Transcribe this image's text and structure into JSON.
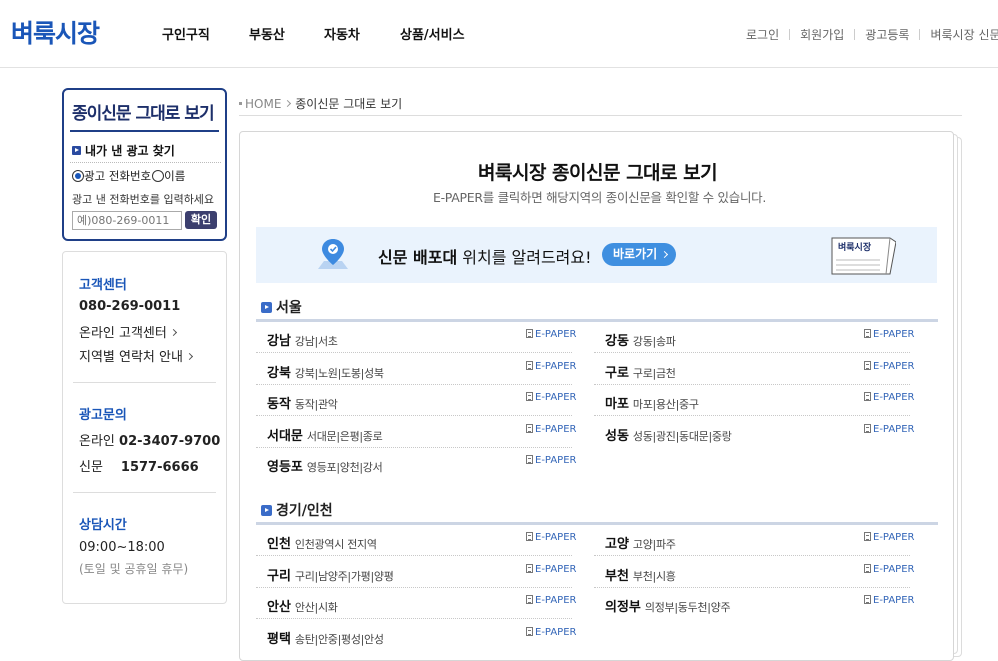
{
  "header": {
    "logo": "벼룩시장",
    "nav": [
      "구인구직",
      "부동산",
      "자동차",
      "상품/서비스"
    ],
    "util": [
      "로그인",
      "회원가입",
      "광고등록",
      "벼룩시장 신문보기"
    ]
  },
  "sidebar": {
    "search": {
      "title": "종이신문 그대로 보기",
      "subtitle": "내가 낸 광고 찾기",
      "radio_phone": "광고 전화번호",
      "radio_name": "이름",
      "hint": "광고 낸 전화번호를 입력하세요",
      "placeholder": "예)080-269-0011",
      "ok": "확인"
    },
    "customer": {
      "title": "고객센터",
      "phone": "080-269-0011",
      "online": "온라인 고객센터",
      "regional": "지역별 연락처 안내"
    },
    "ad": {
      "title": "광고문의",
      "online_label": "온라인",
      "online_phone": "02-3407-9700",
      "paper_label": "신문",
      "paper_phone": "1577-6666"
    },
    "hours": {
      "title": "상담시간",
      "time": "09:00~18:00",
      "note": "(토일 및 공휴일 휴무)"
    }
  },
  "breadcrumb": {
    "home": "HOME",
    "current": "종이신문 그대로 보기"
  },
  "main": {
    "title": "벼룩시장 종이신문 그대로 보기",
    "desc": "E-PAPER를 클릭하면 해당지역의 종이신문을 확인할 수 있습니다.",
    "banner": {
      "bold": "신문 배포대",
      "text": " 위치를 알려드려요!",
      "button": "바로가기",
      "paper_label": "벼룩시장"
    },
    "epaper_label": "E-PAPER",
    "sections": [
      {
        "title": "서울",
        "regions": [
          {
            "name": "강남",
            "sub": "강남|서초"
          },
          {
            "name": "강동",
            "sub": "강동|송파"
          },
          {
            "name": "강북",
            "sub": "강북|노원|도봉|성북"
          },
          {
            "name": "구로",
            "sub": "구로|금천"
          },
          {
            "name": "동작",
            "sub": "동작|관악"
          },
          {
            "name": "마포",
            "sub": "마포|용산|중구"
          },
          {
            "name": "서대문",
            "sub": "서대문|은평|종로"
          },
          {
            "name": "성동",
            "sub": "성동|광진|동대문|중랑"
          },
          {
            "name": "영등포",
            "sub": "영등포|양천|강서"
          }
        ]
      },
      {
        "title": "경기/인천",
        "regions": [
          {
            "name": "인천",
            "sub": "인천광역시 전지역"
          },
          {
            "name": "고양",
            "sub": "고양|파주"
          },
          {
            "name": "구리",
            "sub": "구리|남양주|가평|양평"
          },
          {
            "name": "부천",
            "sub": "부천|시흥"
          },
          {
            "name": "안산",
            "sub": "안산|시화"
          },
          {
            "name": "의정부",
            "sub": "의정부|동두천|양주"
          },
          {
            "name": "평택",
            "sub": "송탄|안중|평성|안성"
          }
        ]
      }
    ]
  }
}
